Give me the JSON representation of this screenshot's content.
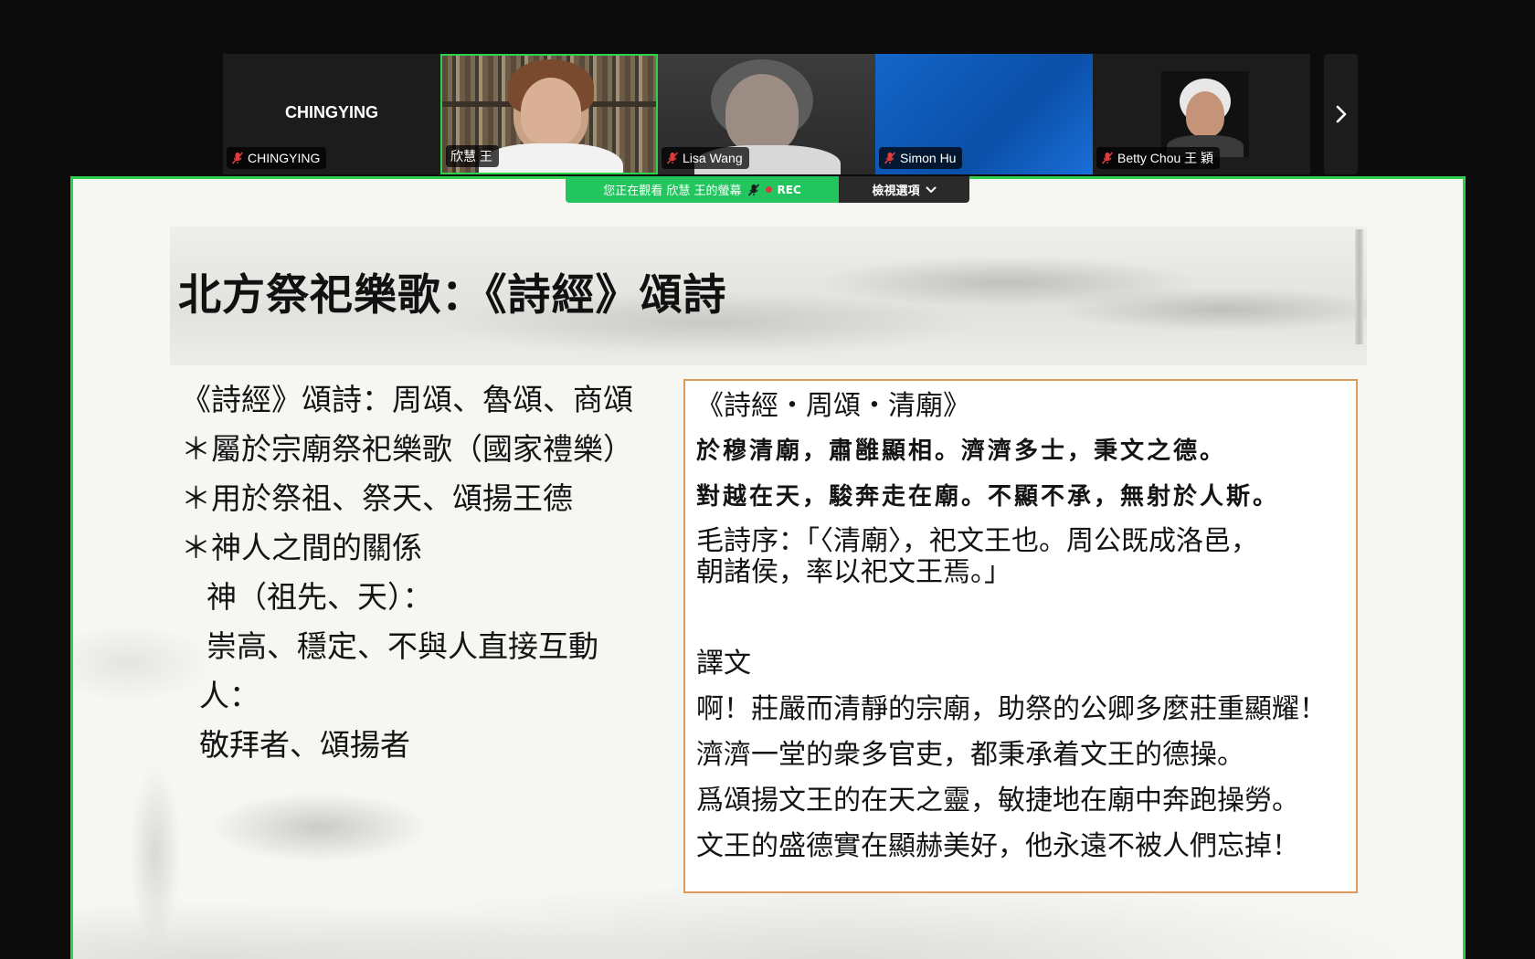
{
  "participants": [
    {
      "name": "CHINGYING",
      "center_label": "CHINGYING",
      "muted": true,
      "active": false,
      "video": "none"
    },
    {
      "name": "欣慧 王",
      "muted": false,
      "active": true,
      "video": "camera"
    },
    {
      "name": "Lisa Wang",
      "muted": true,
      "active": false,
      "video": "camera"
    },
    {
      "name": "Simon Hu",
      "muted": true,
      "active": false,
      "video": "blue-background"
    },
    {
      "name": "Betty Chou 王 穎",
      "muted": true,
      "active": false,
      "video": "profile-photo"
    }
  ],
  "share_bar": {
    "viewing_text": "您正在觀看 欣慧 王的螢幕",
    "rec_label": "REC",
    "view_options_label": "檢視選項"
  },
  "slide": {
    "title": "北方祭祀樂歌：《詩經》頌詩",
    "left_lines": [
      "《詩經》頌詩：周頌、魯頌、商頌",
      "＊屬於宗廟祭祀樂歌（國家禮樂）",
      "＊用於祭祖、祭天、頌揚王德",
      "＊神人之間的關係",
      "神（祖先、天）：",
      "崇高、穩定、不與人直接互動",
      "人：",
      "敬拜者、頌揚者"
    ],
    "right_box": {
      "heading": "《詩經・周頌・清廟》",
      "poem_lines": [
        "於穆清廟，肅雝顯相。濟濟多士，秉文之德。",
        "對越在天，駿奔走在廟。不顯不承，無射於人斯。"
      ],
      "preface_lines": [
        "毛詩序：「〈清廟〉，祀文王也。周公既成洛邑，",
        "朝諸侯，率以祀文王焉。」"
      ],
      "translation_heading": "譯文",
      "translation_lines": [
        "啊！莊嚴而清靜的宗廟，助祭的公卿多麼莊重顯耀！",
        "濟濟一堂的衆多官吏，都秉承着文王的德操。",
        "爲頌揚文王的在天之靈，敏捷地在廟中奔跑操勞。",
        "文王的盛德實在顯赫美好，他永遠不被人們忘掉！"
      ]
    }
  },
  "colors": {
    "active_border": "#2dd24a",
    "share_green": "#22c55e",
    "textbox_border": "#d99a5a",
    "mute_red": "#e23b3b"
  },
  "icons": {
    "muted_mic": "mic-off-icon",
    "next_page": "chevron-right-icon",
    "view_options": "chevron-down-icon"
  }
}
